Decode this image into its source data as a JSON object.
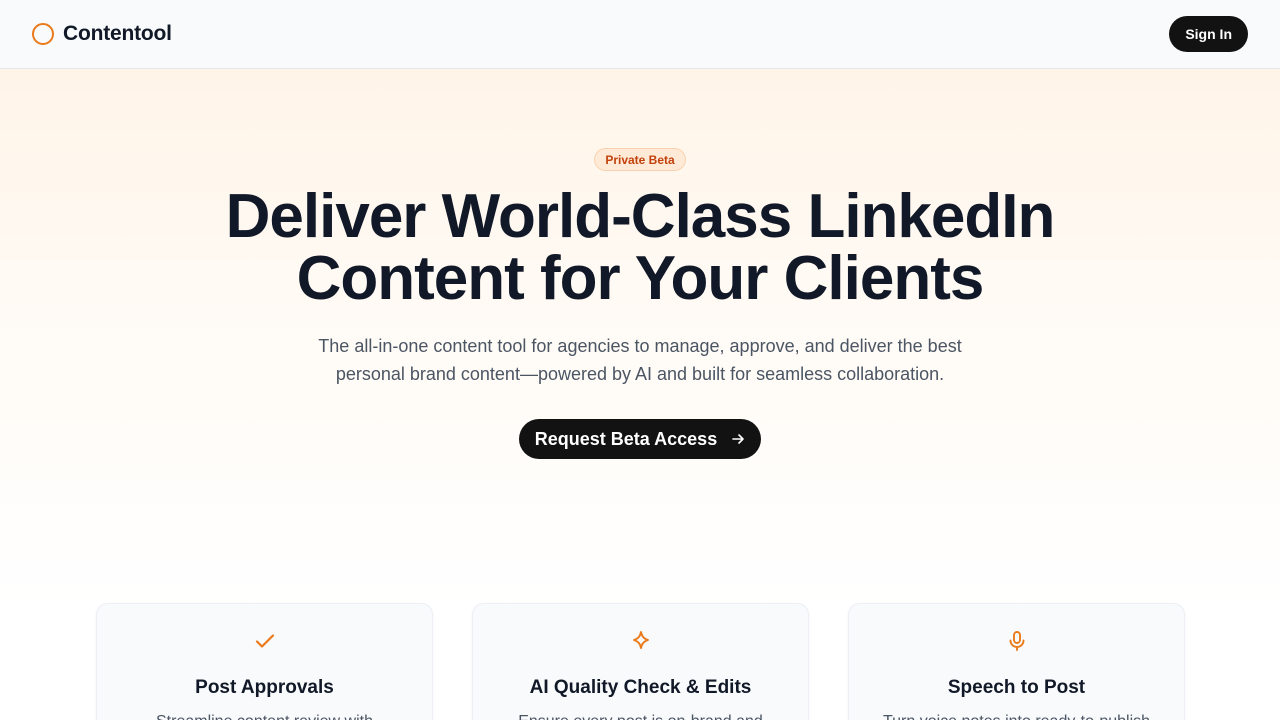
{
  "header": {
    "brand": "Contentool",
    "sign_in_label": "Sign In"
  },
  "hero": {
    "badge": "Private Beta",
    "headline_line1": "Deliver World-Class LinkedIn",
    "headline_line2": "Content for Your Clients",
    "subtitle_line1": "The all-in-one content tool for agencies to manage, approve, and deliver the best",
    "subtitle_line2": "personal brand content—powered by AI and built for seamless collaboration.",
    "cta_label": "Request Beta Access",
    "cta_icon": "arrow-right-icon"
  },
  "features": [
    {
      "icon": "check-icon",
      "title": "Post Approvals",
      "desc": "Streamline content review with"
    },
    {
      "icon": "sparkle-icon",
      "title": "AI Quality Check & Edits",
      "desc": "Ensure every post is on-brand and"
    },
    {
      "icon": "microphone-icon",
      "title": "Speech to Post",
      "desc": "Turn voice notes into ready-to-publish"
    }
  ],
  "colors": {
    "accent": "#ea7a1a",
    "dark_button": "#121212",
    "badge_bg": "#feead6",
    "badge_text": "#c2410c"
  }
}
